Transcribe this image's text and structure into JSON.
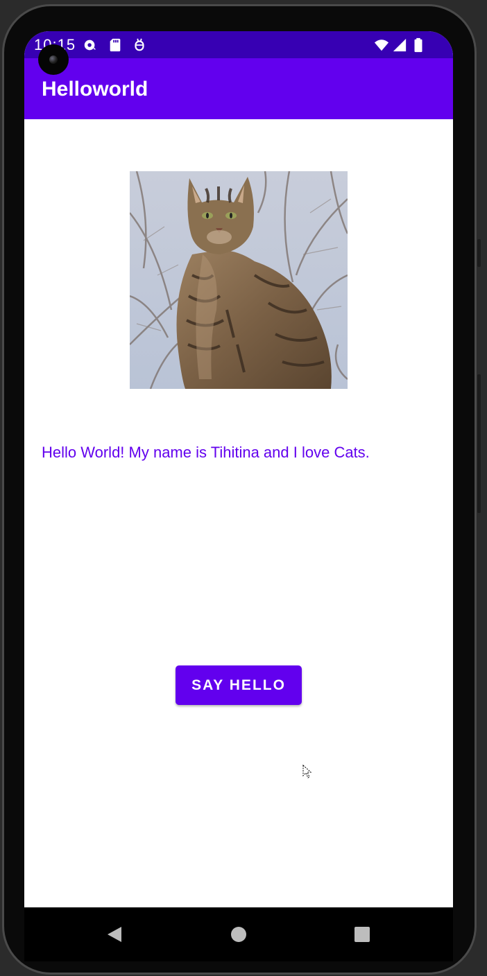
{
  "status_bar": {
    "time": "10:15",
    "left_icons": [
      "sync-icon",
      "sd-card-icon",
      "usb-debug-icon"
    ],
    "right_icons": [
      "wifi-icon",
      "cell-signal-icon",
      "battery-icon"
    ],
    "color": "#3700b3"
  },
  "app_bar": {
    "title": "Helloworld",
    "color": "#6200ee"
  },
  "main": {
    "image_subject": "tabby cat sitting",
    "greeting": "Hello World! My name is Tihitina and I love Cats.",
    "button_label": "SAY HELLO"
  },
  "nav_bar": {
    "icons": [
      "back-icon",
      "home-icon",
      "recents-icon"
    ]
  },
  "colors": {
    "primary": "#6200ee",
    "primary_dark": "#3700b3",
    "on_primary": "#ffffff"
  }
}
